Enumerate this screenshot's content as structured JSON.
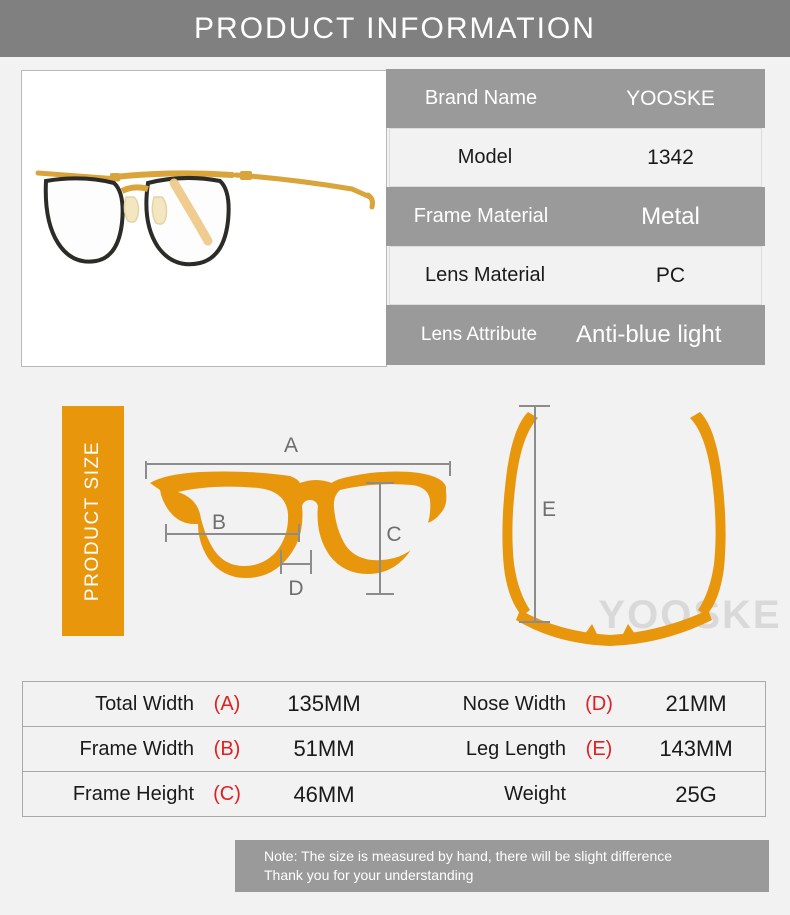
{
  "header": {
    "title": "PRODUCT INFORMATION"
  },
  "colors": {
    "header_gray": "#808080",
    "row_gray": "#9a9a9a",
    "row_white": "#f2f2f2",
    "accent_orange": "#e8960c",
    "code_red": "#e02020",
    "page_background": "#f2f2f2"
  },
  "product_photo": {
    "alt": "gold and black metal eyeglasses front angled view",
    "frame_color": "#d9a43a",
    "rim_color": "#2b2b28"
  },
  "spec_table": {
    "rows": [
      {
        "label": "Brand Name",
        "value": "YOOSKE"
      },
      {
        "label": "Model",
        "value": "1342"
      },
      {
        "label": "Frame Material",
        "value": "Metal"
      },
      {
        "label": "Lens Material",
        "value": "PC"
      },
      {
        "label": "Lens Attribute",
        "value": "Anti-blue light"
      }
    ]
  },
  "size_section": {
    "tab_label": "PRODUCT SIZE",
    "watermark": "YOOSKE",
    "front_view": {
      "dimension_labels": [
        "A",
        "B",
        "C",
        "D"
      ]
    },
    "top_view": {
      "dimension_labels": [
        "E"
      ]
    }
  },
  "measurement_table": {
    "rows": [
      {
        "left": {
          "name": "Total Width",
          "code": "(A)",
          "value": "135MM"
        },
        "right": {
          "name": "Nose Width",
          "code": "(D)",
          "value": "21MM"
        }
      },
      {
        "left": {
          "name": "Frame Width",
          "code": "(B)",
          "value": "51MM"
        },
        "right": {
          "name": "Leg Length",
          "code": "(E)",
          "value": "143MM"
        }
      },
      {
        "left": {
          "name": "Frame Height",
          "code": "(C)",
          "value": "46MM"
        },
        "right": {
          "name": "Weight",
          "code": "",
          "value": "25G"
        }
      }
    ]
  },
  "note": {
    "line1": "Note: The size is measured by hand, there will be slight difference",
    "line2": "Thank you for your understanding"
  }
}
